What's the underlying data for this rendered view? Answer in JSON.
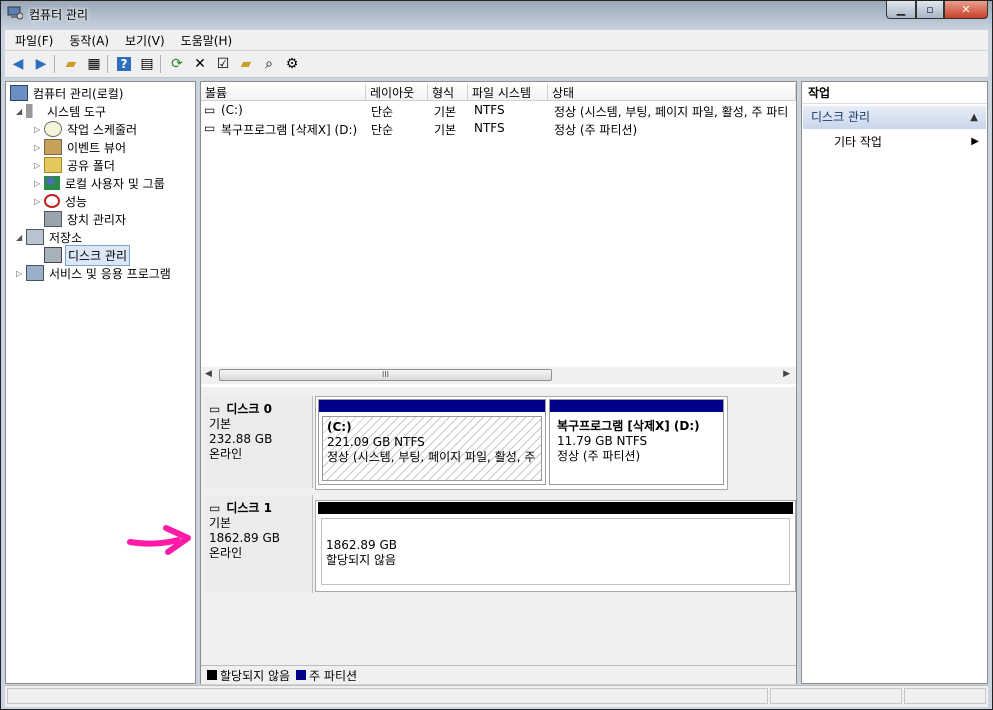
{
  "window": {
    "title": "컴퓨터 관리"
  },
  "menu": [
    "파일(F)",
    "동작(A)",
    "보기(V)",
    "도움말(H)"
  ],
  "tree": {
    "root": "컴퓨터 관리(로컬)",
    "system_tools": "시스템 도구",
    "task_scheduler": "작업 스케줄러",
    "event_viewer": "이벤트 뷰어",
    "shared_folders": "공유 폴더",
    "local_users": "로컬 사용자 및 그룹",
    "performance": "성능",
    "device_manager": "장치 관리자",
    "storage": "저장소",
    "disk_management": "디스크 관리",
    "services": "서비스 및 응용 프로그램"
  },
  "volume_list": {
    "columns": [
      "볼륨",
      "레이아웃",
      "형식",
      "파일 시스템",
      "상태"
    ],
    "rows": [
      {
        "volume": "(C:)",
        "layout": "단순",
        "type": "기본",
        "fs": "NTFS",
        "status": "정상 (시스템, 부팅, 페이지 파일, 활성, 주 파티"
      },
      {
        "volume": "복구프로그램 [삭제X] (D:)",
        "layout": "단순",
        "type": "기본",
        "fs": "NTFS",
        "status": "정상 (주 파티션)"
      }
    ],
    "scroll_thumb": "III"
  },
  "disks": [
    {
      "name": "디스크 0",
      "kind": "기본",
      "size": "232.88 GB",
      "state": "온라인",
      "partitions": [
        {
          "name": "(C:)",
          "size": "221.09 GB NTFS",
          "status": "정상 (시스템, 부팅, 페이지 파일, 활성, 주"
        },
        {
          "name": "복구프로그램 [삭제X]  (D:)",
          "size": "11.79 GB NTFS",
          "status": "정상 (주 파티션)"
        }
      ]
    },
    {
      "name": "디스크 1",
      "kind": "기본",
      "size": "1862.89 GB",
      "state": "온라인",
      "partitions": [
        {
          "size": "1862.89 GB",
          "status": "할당되지 않음"
        }
      ]
    }
  ],
  "legend": [
    {
      "label": "할당되지 않음",
      "color": "#000000"
    },
    {
      "label": "주 파티션",
      "color": "#00008b"
    }
  ],
  "actions": {
    "header": "작업",
    "section": "디스크 관리",
    "more": "기타 작업"
  },
  "colors": {
    "primary_partition": "#00008b",
    "unallocated": "#000000",
    "annotation_arrow": "#ff1aa8"
  }
}
